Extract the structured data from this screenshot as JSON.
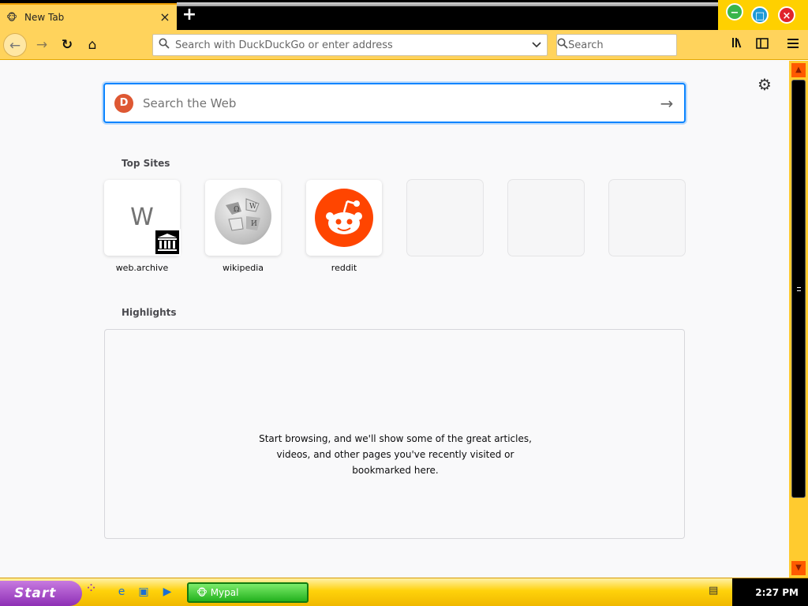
{
  "tab": {
    "title": "New Tab",
    "close": "×"
  },
  "newtab": "+",
  "window": {
    "minimize": "−",
    "maximize": "□",
    "close": "×"
  },
  "toolbar": {
    "back_icon": "←",
    "forward_icon": "→",
    "reload_icon": "↻",
    "home_icon": "⌂",
    "url_placeholder": "Search with DuckDuckGo or enter address",
    "search_placeholder": "Search",
    "library_icon": "|||\\",
    "sidebar_icon": "◫",
    "menu_icon": "≡",
    "search_glyph": "⚲",
    "dropdown_glyph": "⌄"
  },
  "newtab_page": {
    "settings_icon": "⚙",
    "web_search_placeholder": "Search the Web",
    "go_icon": "→",
    "top_sites_title": "Top Sites",
    "top_sites": [
      {
        "label": "web.archive",
        "letter": "W"
      },
      {
        "label": "wikipedia"
      },
      {
        "label": "reddit"
      },
      {
        "label": ""
      },
      {
        "label": ""
      },
      {
        "label": ""
      }
    ],
    "highlights_title": "Highlights",
    "highlights_empty": "Start browsing, and we'll show some of the great articles, videos, and other pages you've recently visited or bookmarked here."
  },
  "taskbar": {
    "start_label": "Start",
    "task_mypal": "Mypal",
    "clock": "2:27 PM"
  },
  "colors": {
    "accent": "#ffd35c",
    "focus": "#0a84ff",
    "reddit": "#ff4500",
    "duckduckgo": "#de5833",
    "taskbar": "#ffd20a",
    "task_active": "#23b11e"
  }
}
